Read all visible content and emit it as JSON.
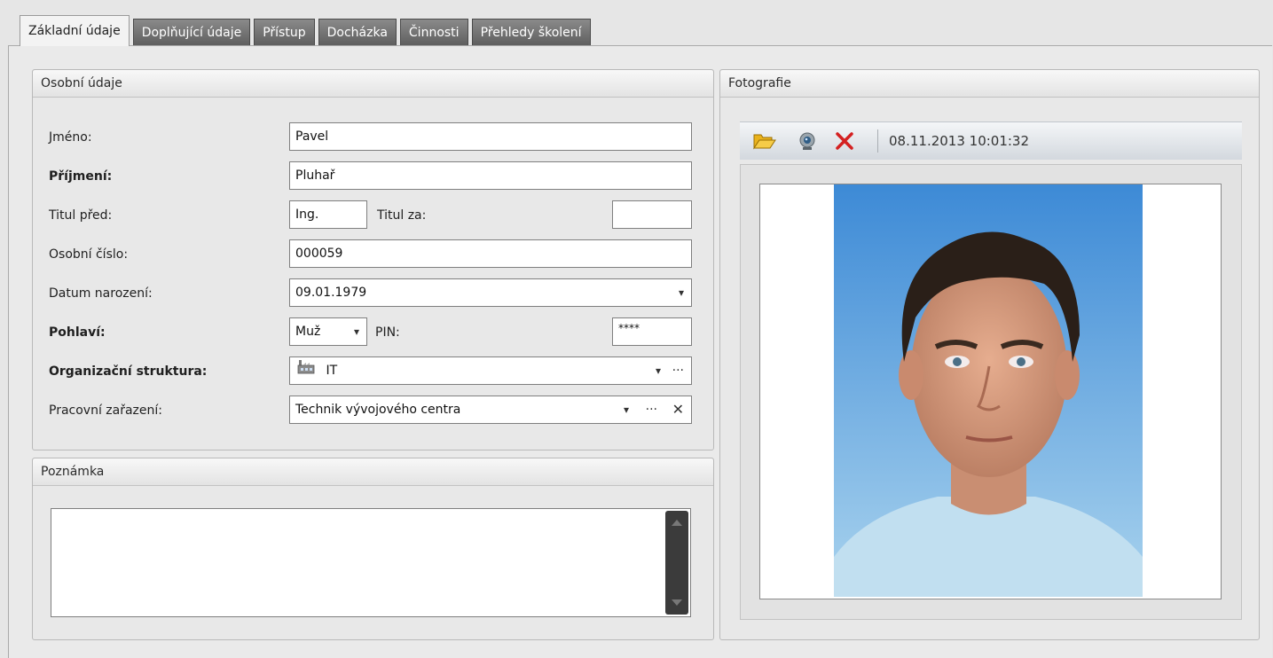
{
  "tabs": [
    {
      "label": "Základní údaje",
      "active": true
    },
    {
      "label": "Doplňující údaje"
    },
    {
      "label": "Přístup"
    },
    {
      "label": "Docházka"
    },
    {
      "label": "Činnosti"
    },
    {
      "label": "Přehledy školení"
    }
  ],
  "personal": {
    "title": "Osobní údaje",
    "jmeno_label": "Jméno:",
    "jmeno_value": "Pavel",
    "prijmeni_label": "Příjmení:",
    "prijmeni_value": "Pluhař",
    "titul_pred_label": "Titul před:",
    "titul_pred_value": "Ing.",
    "titul_za_label": "Titul za:",
    "titul_za_value": "",
    "osobni_cislo_label": "Osobní číslo:",
    "osobni_cislo_value": "000059",
    "datum_label": "Datum narození:",
    "datum_value": "09.01.1979",
    "pohlavi_label": "Pohlaví:",
    "pohlavi_value": "Muž",
    "pin_label": "PIN:",
    "pin_value": "****",
    "org_label": "Organizační struktura:",
    "org_value": "IT",
    "prac_label": "Pracovní zařazení:",
    "prac_value": "Technik vývojového centra"
  },
  "note": {
    "title": "Poznámka",
    "value": ""
  },
  "photo": {
    "title": "Fotografie",
    "timestamp": "08.11.2013 10:01:32",
    "icons": [
      "folder-open-icon",
      "webcam-icon",
      "delete-icon"
    ]
  },
  "colors": {
    "tab_inactive": "#6e6e6e",
    "delete_red": "#d42020",
    "folder_yellow": "#f0b400"
  }
}
